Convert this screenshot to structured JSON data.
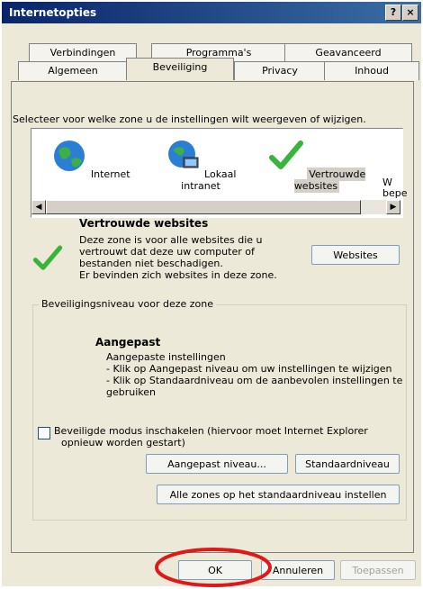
{
  "window": {
    "title": "Internetopties",
    "help_glyph": "?",
    "close_glyph": "×"
  },
  "tabs_row1": [
    "Verbindingen",
    "Programma's",
    "Geavanceerd"
  ],
  "tabs_row2": [
    "Algemeen",
    "Beveiliging",
    "Privacy",
    "Inhoud"
  ],
  "active_tab": "Beveiliging",
  "zone_prompt": "Selecteer voor welke zone u de instellingen wilt weergeven of wijzigen.",
  "zones": [
    {
      "label": "Internet",
      "icon": "globe-icon"
    },
    {
      "label": "Lokaal intranet",
      "icon": "intranet-globe-icon"
    },
    {
      "label": "Vertrouwde websites",
      "icon": "green-check-icon"
    },
    {
      "label": "W",
      "label2": "bepe",
      "icon": "restricted-icon"
    }
  ],
  "selected_zone": {
    "title": "Vertrouwde websites",
    "desc_lines": [
      "Deze zone is voor alle websites die u",
      "vertrouwt dat deze uw computer of",
      "bestanden niet beschadigen.",
      "Er bevinden zich websites in deze zone."
    ],
    "sites_button": "Websites"
  },
  "security_level": {
    "legend": "Beveiligingsniveau voor deze zone",
    "level_name": "Aangepast",
    "lines": [
      "Aangepaste instellingen",
      "- Klik op Aangepast niveau om uw instellingen te wijzigen",
      "- Klik op Standaardniveau om de aanbevolen instellingen te",
      "gebruiken"
    ],
    "protected_mode_label_1": "Beveiligde modus inschakelen (hiervoor moet Internet Explorer",
    "protected_mode_label_2": "opnieuw worden gestart)",
    "custom_level_button": "Aangepast niveau...",
    "default_level_button": "Standaardniveau",
    "reset_all_button": "Alle zones op het standaardniveau instellen"
  },
  "footer": {
    "ok": "OK",
    "cancel": "Annuleren",
    "apply": "Toepassen"
  },
  "colors": {
    "highlight_circle": "#e01818",
    "titlebar": "#0a246a"
  }
}
